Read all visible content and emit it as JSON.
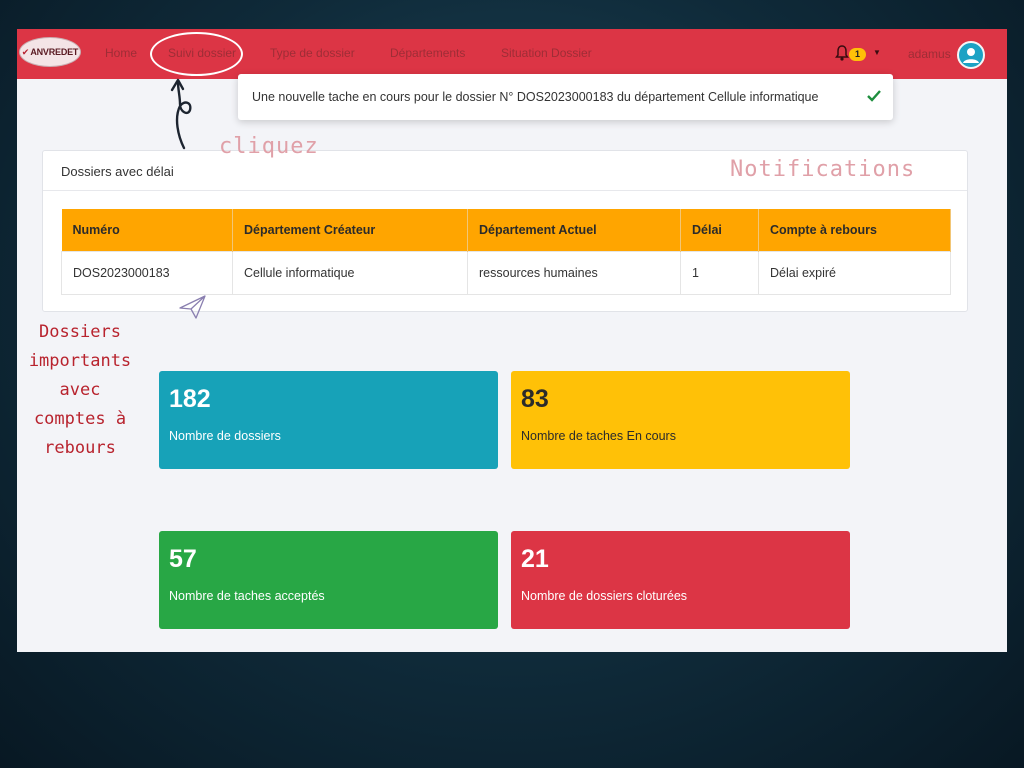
{
  "app": {
    "logo_text": "ANVREDET"
  },
  "nav": {
    "items": [
      {
        "label": "Home"
      },
      {
        "label": "Suivi dossier"
      },
      {
        "label": "Type de dossier"
      },
      {
        "label": "Départements"
      },
      {
        "label": "Situation Dossier"
      }
    ],
    "notification_count": "1",
    "username": "adamus"
  },
  "toast": {
    "message": "Une nouvelle tache en cours pour le dossier N° DOS2023000183 du département Cellule informatique"
  },
  "dossiers_card": {
    "title": "Dossiers avec délai",
    "columns": [
      "Numéro",
      "Département Créateur",
      "Département Actuel",
      "Délai",
      "Compte à rebours"
    ],
    "rows": [
      [
        "DOS2023000183",
        "Cellule informatique",
        "ressources humaines",
        "1",
        "Délai expiré"
      ]
    ]
  },
  "stats": [
    {
      "value": "182",
      "label": "Nombre de dossiers",
      "color": "#17a2b8",
      "text_color": "#ffffff"
    },
    {
      "value": "83",
      "label": "Nombre de taches En cours",
      "color": "#ffc107",
      "text_color": "#2b2b2b"
    },
    {
      "value": "57",
      "label": "Nombre de taches acceptés",
      "color": "#28a745",
      "text_color": "#ffffff"
    },
    {
      "value": "21",
      "label": "Nombre de dossiers cloturées",
      "color": "#dc3545",
      "text_color": "#ffffff"
    }
  ],
  "annotations": {
    "cliquez": "cliquez",
    "notifications": "Notifications",
    "dossiers_lines": [
      "Dossiers",
      "importants",
      "avec",
      "comptes à",
      "rebours"
    ]
  },
  "colors": {
    "navbar": "#dc3545",
    "table_header": "#ffa500",
    "annotation_text": "#e0a0a8",
    "annotation_text_dark": "#b8232e"
  },
  "icons": {
    "bell": "bell-icon",
    "caret": "caret-down-icon",
    "avatar": "user-icon",
    "check": "check-icon",
    "arrow": "hand-drawn-arrow-icon",
    "paper_plane": "paper-plane-icon"
  }
}
